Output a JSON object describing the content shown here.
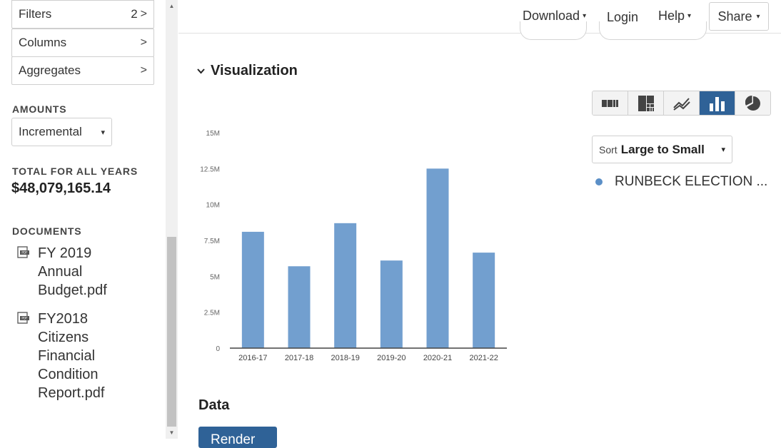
{
  "sidebar": {
    "filters": {
      "label": "Filters",
      "count": "2",
      "chevron": ">"
    },
    "columns": {
      "label": "Columns",
      "chevron": ">"
    },
    "aggregates": {
      "label": "Aggregates",
      "chevron": ">"
    },
    "amounts": {
      "heading": "AMOUNTS",
      "selected": "Incremental",
      "caret": "▾"
    },
    "total": {
      "heading": "TOTAL FOR ALL YEARS",
      "value": "$48,079,165.14"
    },
    "documents": {
      "heading": "DOCUMENTS",
      "items": [
        {
          "lines": [
            "FY 2019",
            "Annual",
            "Budget.pdf"
          ]
        },
        {
          "lines": [
            "FY2018",
            "Citizens",
            "Financial",
            "Condition",
            "Report.pdf"
          ]
        }
      ]
    }
  },
  "topbar": {
    "download": "Download",
    "login": "Login",
    "help": "Help",
    "share": "Share",
    "caret": "▾"
  },
  "visualization": {
    "heading": "Visualization",
    "chart_types": [
      {
        "name": "table-view-icon",
        "active": false
      },
      {
        "name": "treemap-icon",
        "active": false
      },
      {
        "name": "line-chart-icon",
        "active": false
      },
      {
        "name": "bar-chart-icon",
        "active": true
      },
      {
        "name": "pie-chart-icon",
        "active": false
      }
    ],
    "sort": {
      "prefix": "Sort",
      "value": "Large to Small",
      "caret": "▾"
    },
    "legend": {
      "label": "RUNBECK ELECTION ...",
      "color": "#5b8fc7"
    }
  },
  "chart_data": {
    "type": "bar",
    "categories": [
      "2016-17",
      "2017-18",
      "2018-19",
      "2019-20",
      "2020-21",
      "2021-22"
    ],
    "series": [
      {
        "name": "RUNBECK ELECTION ...",
        "values": [
          8100000,
          5700000,
          8700000,
          6100000,
          12500000,
          6650000
        ]
      }
    ],
    "ylim": [
      0,
      15000000
    ],
    "yticks": [
      0,
      2500000,
      5000000,
      7500000,
      10000000,
      12500000,
      15000000
    ],
    "ytick_labels": [
      "0",
      "2.5M",
      "5M",
      "7.5M",
      "10M",
      "12.5M",
      "15M"
    ],
    "bar_color": "#729fcf",
    "grid": false
  },
  "data_section": {
    "heading": "Data",
    "button_label": "Render"
  },
  "colors": {
    "accent": "#2f6297",
    "bar": "#729fcf"
  }
}
